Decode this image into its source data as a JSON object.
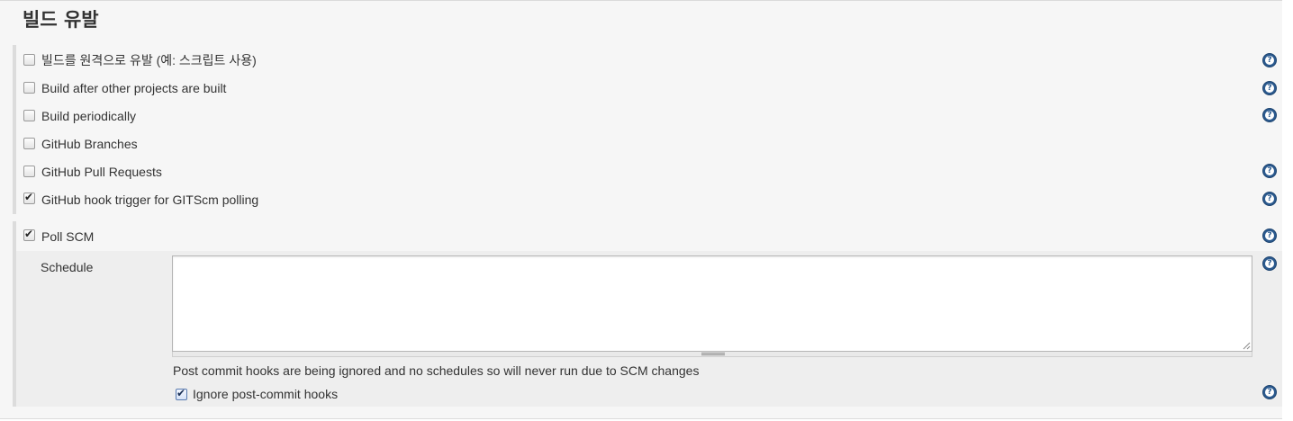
{
  "section": {
    "title": "빌드 유발"
  },
  "triggers": [
    {
      "label": "빌드를 원격으로 유발 (예: 스크립트 사용)",
      "checked": false,
      "help": true
    },
    {
      "label": "Build after other projects are built",
      "checked": false,
      "help": true
    },
    {
      "label": "Build periodically",
      "checked": false,
      "help": true
    },
    {
      "label": "GitHub Branches",
      "checked": false,
      "help": false
    },
    {
      "label": "GitHub Pull Requests",
      "checked": false,
      "help": true
    },
    {
      "label": "GitHub hook trigger for GITScm polling",
      "checked": true,
      "help": true
    },
    {
      "label": "Poll SCM",
      "checked": true,
      "help": true
    }
  ],
  "poll_scm": {
    "schedule_label": "Schedule",
    "schedule_value": "",
    "note": "Post commit hooks are being ignored and no schedules so will never run due to SCM changes",
    "ignore_hooks_label": "Ignore post-commit hooks",
    "ignore_hooks_checked": true
  },
  "icons": {
    "help": "help-question-icon",
    "check": "checkmark-icon"
  },
  "colors": {
    "help_icon": "#2b5a8f",
    "background": "#f6f6f6",
    "group_bar": "#dcdcdc"
  }
}
